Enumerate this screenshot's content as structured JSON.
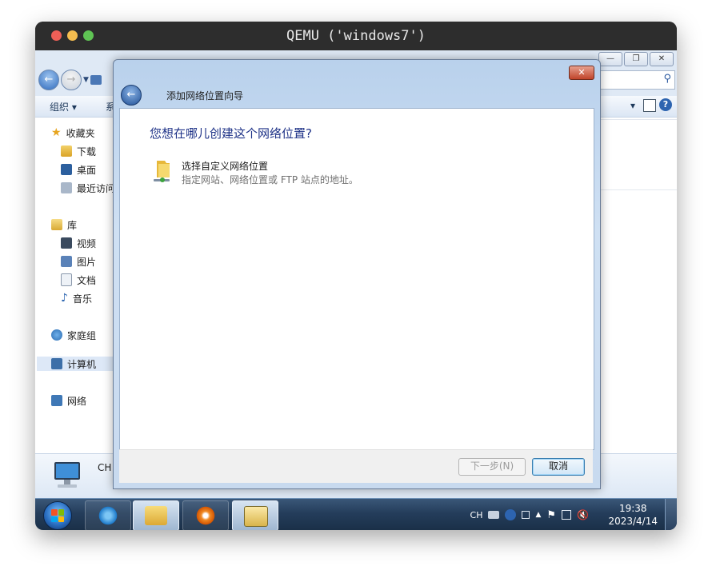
{
  "host": {
    "title": "QEMU ('windows7')"
  },
  "explorer": {
    "caption_buttons": [
      "—",
      "❐",
      "✕"
    ],
    "toolbar": {
      "organize": "组织 ▾",
      "second": "系",
      "arrow": "▾"
    },
    "nav": {
      "favorites": "收藏夹",
      "downloads": "下载",
      "desktop": "桌面",
      "recent": "最近访问",
      "libraries": "库",
      "videos": "视频",
      "pictures": "图片",
      "documents": "文档",
      "music": "音乐",
      "homegroup": "家庭组",
      "computer": "计算机",
      "network": "网络"
    },
    "details_text": "CH"
  },
  "dialog": {
    "title": "添加网络位置向导",
    "heading": "您想在哪儿创建这个网络位置?",
    "option_label": "选择自定义网络位置",
    "option_desc": "指定网站、网络位置或 FTP 站点的地址。",
    "next_button": "下一步(N)",
    "cancel_button": "取消",
    "close_glyph": "✕",
    "back_glyph": "←"
  },
  "taskbar": {
    "lang": "CH",
    "time": "19:38",
    "date": "2023/4/14"
  }
}
